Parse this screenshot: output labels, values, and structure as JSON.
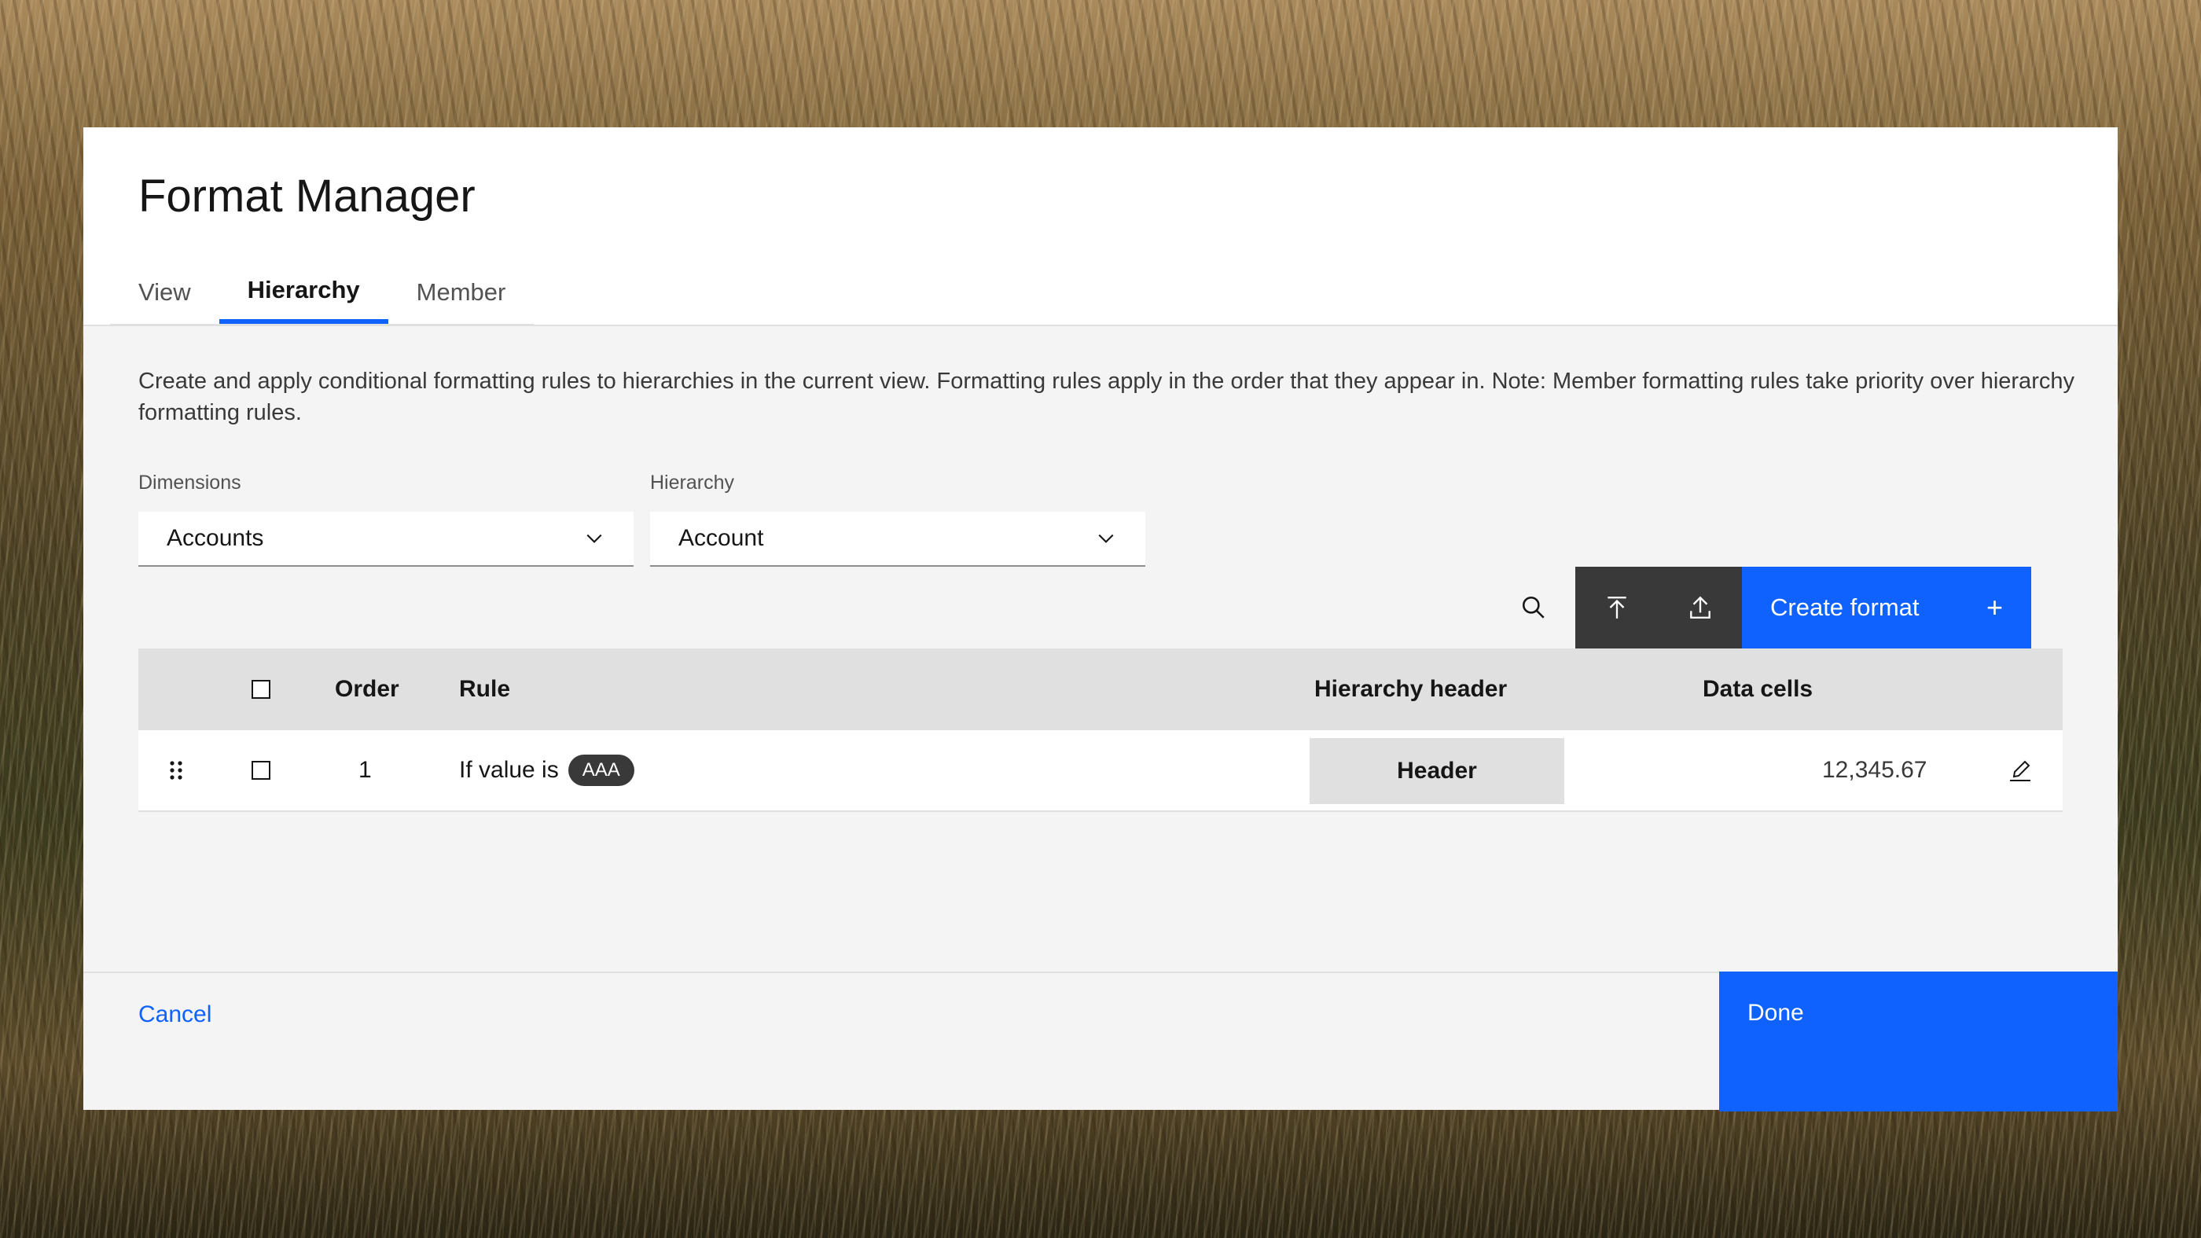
{
  "modal": {
    "title": "Format Manager",
    "tabs": [
      {
        "label": "View",
        "active": false
      },
      {
        "label": "Hierarchy",
        "active": true
      },
      {
        "label": "Member",
        "active": false
      }
    ],
    "description": "Create and apply conditional formatting rules to hierarchies in the current view. Formatting rules apply in the order that they appear in. Note: Member formatting rules take priority over hierarchy formatting rules."
  },
  "filters": {
    "dimensions": {
      "label": "Dimensions",
      "value": "Accounts"
    },
    "hierarchy": {
      "label": "Hierarchy",
      "value": "Account"
    }
  },
  "toolbar": {
    "search_icon": "search-icon",
    "upload_top_icon": "upload-to-top-icon",
    "upload_icon": "upload-icon",
    "create_label": "Create format",
    "create_icon": "+"
  },
  "table": {
    "columns": {
      "order": "Order",
      "rule": "Rule",
      "hierarchy_header": "Hierarchy header",
      "data_cells": "Data cells"
    },
    "rows": [
      {
        "order": "1",
        "rule_text": "If value is",
        "rule_tag": "AAA",
        "header_preview": "Header",
        "data_preview": "12,345.67"
      }
    ]
  },
  "footer": {
    "cancel_label": "Cancel",
    "done_label": "Done"
  },
  "colors": {
    "accent": "#0f62fe",
    "dark_button": "#393939",
    "modal_bg": "#f4f4f4"
  }
}
